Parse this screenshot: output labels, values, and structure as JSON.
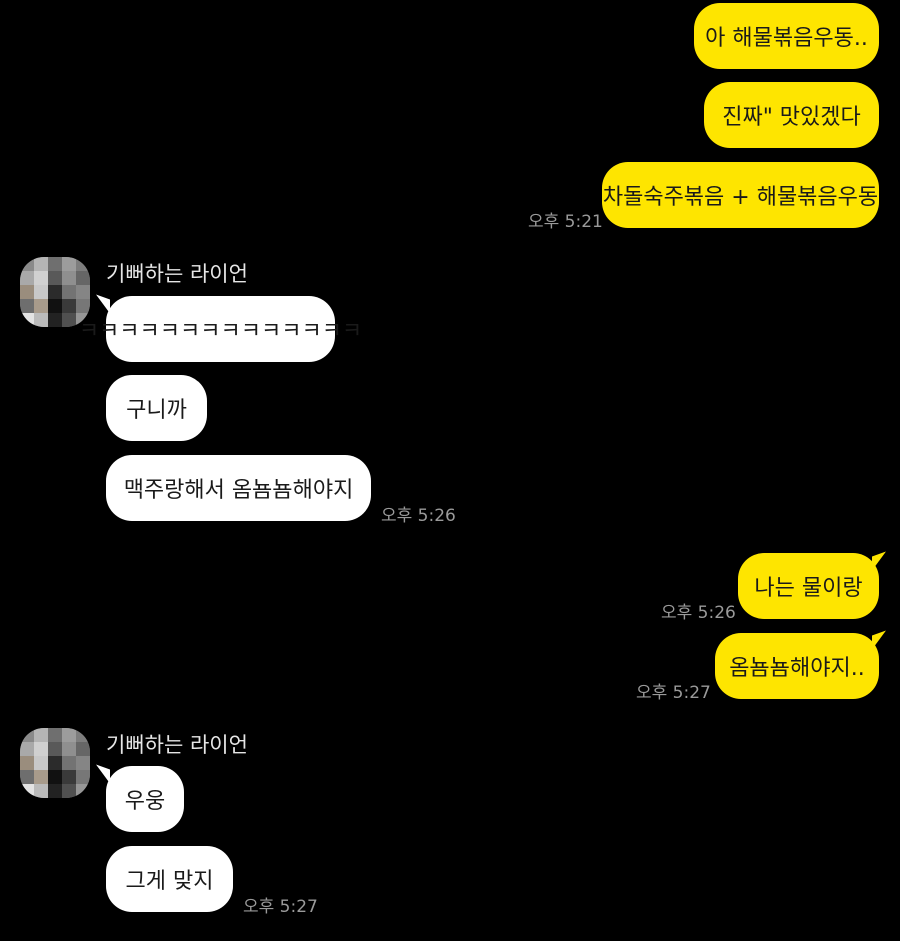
{
  "chat": {
    "messages_me": [
      {
        "text": "아 해물볶음우동.."
      },
      {
        "text": "진짜\" 맛있겠다"
      },
      {
        "text": "차돌숙주볶음 + 해물볶음우동",
        "time": "오후 5:21"
      },
      {
        "text": "나는 물이랑",
        "time": "오후 5:26"
      },
      {
        "text": "옴뇸뇸해야지..",
        "time": "오후 5:27"
      }
    ],
    "group1": {
      "sender": "기뻐하는 라이언",
      "messages": [
        {
          "text": "ㅋㅋㅋㅋㅋㅋㅋㅋㅋㅋㅋㅋㅋㅋ"
        },
        {
          "text": "구니까"
        },
        {
          "text": "맥주랑해서 옴뇸뇸해야지",
          "time": "오후 5:26"
        }
      ]
    },
    "group2": {
      "sender": "기뻐하는 라이언",
      "messages": [
        {
          "text": "우웅"
        },
        {
          "text": "그게 맞지",
          "time": "오후 5:27"
        }
      ]
    },
    "colors": {
      "background": "#000000",
      "my_bubble": "#FEE500",
      "their_bubble": "#FFFFFF",
      "time_text": "#9A9A9A"
    }
  }
}
